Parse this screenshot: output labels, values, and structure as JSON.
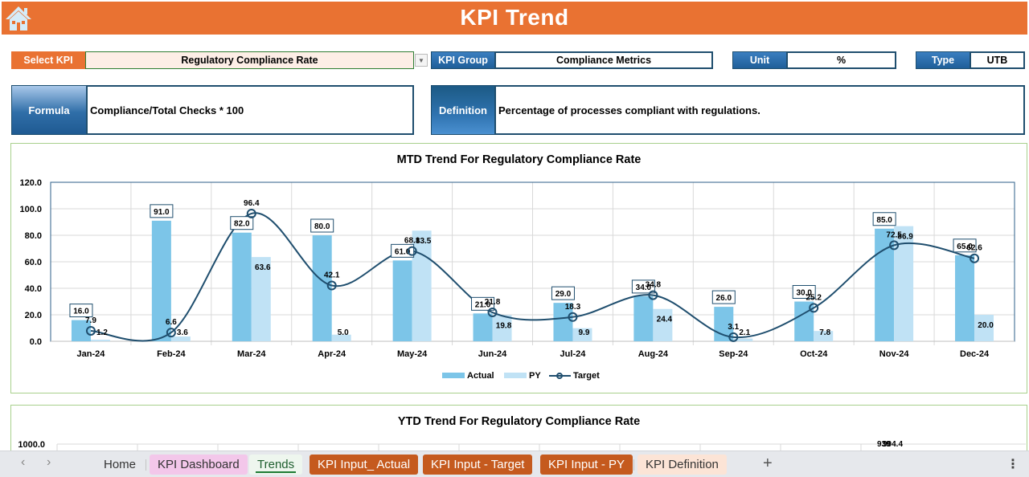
{
  "header": {
    "title": "KPI Trend",
    "home_icon": "home-icon"
  },
  "selectors": {
    "select_kpi_label": "Select KPI",
    "select_kpi_value": "Regulatory Compliance Rate",
    "kpi_group_label": "KPI Group",
    "kpi_group_value": "Compliance Metrics",
    "unit_label": "Unit",
    "unit_value": "%",
    "type_label": "Type",
    "type_value": "UTB"
  },
  "info": {
    "formula_label": "Formula",
    "formula_value": "Compliance/Total Checks * 100",
    "definition_label": "Definition",
    "definition_value": "Percentage of processes compliant with regulations."
  },
  "colors": {
    "header_orange": "#e97232",
    "actual": "#7cc5e8",
    "py": "#c0e2f5",
    "target": "#1f4e6e",
    "panel_border": "#a8d08d"
  },
  "chart_data": [
    {
      "type": "bar",
      "title": "MTD Trend For Regulatory Compliance Rate",
      "xlabel": "",
      "ylabel": "",
      "ylim": [
        0,
        120
      ],
      "yticks": [
        "0.0",
        "20.0",
        "40.0",
        "60.0",
        "80.0",
        "100.0",
        "120.0"
      ],
      "grid": true,
      "legend_position": "bottom",
      "categories": [
        "Jan-24",
        "Feb-24",
        "Mar-24",
        "Apr-24",
        "May-24",
        "Jun-24",
        "Jul-24",
        "Aug-24",
        "Sep-24",
        "Oct-24",
        "Nov-24",
        "Dec-24"
      ],
      "series": [
        {
          "name": "Actual",
          "kind": "bar",
          "values": [
            16.0,
            91.0,
            82.0,
            80.0,
            61.0,
            21.0,
            29.0,
            34.0,
            26.0,
            30.0,
            85.0,
            65.0
          ]
        },
        {
          "name": "PY",
          "kind": "bar",
          "values": [
            1.2,
            3.6,
            63.6,
            5.0,
            83.5,
            19.8,
            9.9,
            24.4,
            2.1,
            7.8,
            86.9,
            20.0
          ]
        },
        {
          "name": "Target",
          "kind": "line",
          "values": [
            7.9,
            6.6,
            96.4,
            42.1,
            68.1,
            21.8,
            18.3,
            34.8,
            3.1,
            25.2,
            72.5,
            62.6
          ]
        }
      ]
    },
    {
      "type": "bar",
      "title": "YTD Trend For Regulatory Compliance Rate",
      "yticks_visible": [
        "1000.0"
      ],
      "partial_labels": [
        "939",
        "904.4"
      ],
      "note": "chart partially visible, cut off by sheet tab bar"
    }
  ],
  "sheet_tabs": [
    {
      "label": "Home",
      "style": "plain"
    },
    {
      "label": "KPI Dashboard",
      "style": "pink"
    },
    {
      "label": "Trends",
      "style": "active"
    },
    {
      "label": "KPI Input_ Actual",
      "style": "brown"
    },
    {
      "label": "KPI Input - Target",
      "style": "brown"
    },
    {
      "label": "KPI Input - PY",
      "style": "brown"
    },
    {
      "label": "KPI Definition",
      "style": "peach"
    }
  ],
  "sheet_controls": {
    "prev": "‹",
    "next": "›",
    "add": "+",
    "more": "⋮"
  }
}
